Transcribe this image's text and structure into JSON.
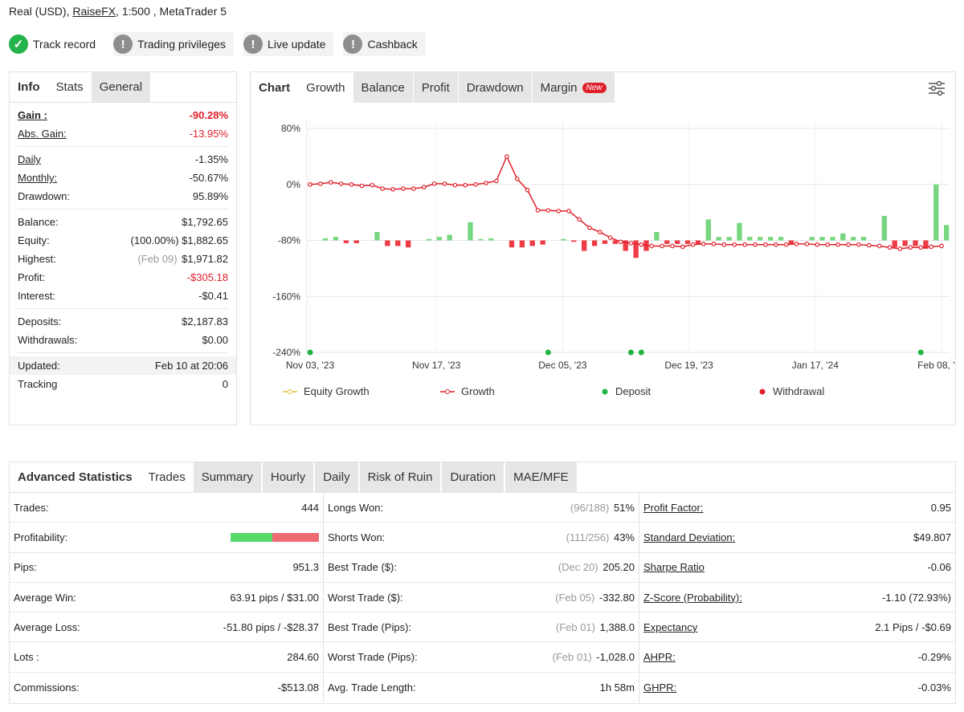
{
  "header": {
    "account_type": "Real (USD),",
    "broker": "RaiseFX",
    "leverage_platform": ", 1:500 , MetaTrader 5"
  },
  "badges": [
    {
      "label": "Track record",
      "status": "ok"
    },
    {
      "label": "Trading privileges",
      "status": "warn"
    },
    {
      "label": "Live update",
      "status": "warn"
    },
    {
      "label": "Cashback",
      "status": "warn"
    }
  ],
  "info": {
    "tabs": [
      "Info",
      "Stats",
      "General"
    ],
    "gain_label": "Gain :",
    "gain": "-90.28%",
    "abs_gain_label": "Abs. Gain:",
    "abs_gain": "-13.95%",
    "daily_label": "Daily",
    "daily": "-1.35%",
    "monthly_label": "Monthly:",
    "monthly": "-50.67%",
    "drawdown_label": "Drawdown:",
    "drawdown": "95.89%",
    "balance_label": "Balance:",
    "balance": "$1,792.65",
    "equity_label": "Equity:",
    "equity_pct": "(100.00%)",
    "equity": "$1,882.65",
    "highest_label": "Highest:",
    "highest_date": "(Feb 09)",
    "highest": "$1,971.82",
    "profit_label": "Profit:",
    "profit": "-$305.18",
    "interest_label": "Interest:",
    "interest": "-$0.41",
    "deposits_label": "Deposits:",
    "deposits": "$2,187.83",
    "withdrawals_label": "Withdrawals:",
    "withdrawals": "$0.00",
    "updated_label": "Updated:",
    "updated": "Feb 10 at 20:06",
    "tracking_label": "Tracking",
    "tracking": "0"
  },
  "chart_tabs": {
    "title": "Chart",
    "tabs": [
      "Growth",
      "Balance",
      "Profit",
      "Drawdown",
      "Margin"
    ],
    "new_badge": "New"
  },
  "chart_data": {
    "type": "line",
    "y_ticks": [
      "80%",
      "0%",
      "-80%",
      "-160%",
      "-240%"
    ],
    "ylim": [
      -240,
      80
    ],
    "x_ticks": [
      "Nov 03, '23",
      "Nov 17, '23",
      "Dec 05, '23",
      "Dec 19, '23",
      "Jan 17, '24",
      "Feb 08, '24"
    ],
    "growth": [
      0,
      1,
      3,
      1,
      0,
      -2,
      -1,
      -6,
      -7,
      -6,
      -6,
      -4,
      1,
      1,
      -1,
      -1,
      0,
      2,
      5,
      40,
      8,
      -8,
      -37,
      -37,
      -38,
      -38,
      -50,
      -62,
      -68,
      -76,
      -82,
      -84,
      -86,
      -88,
      -88,
      -88,
      -89,
      -86,
      -85,
      -85,
      -86,
      -86,
      -86,
      -86,
      -86,
      -86,
      -86,
      -85,
      -85,
      -86,
      -86,
      -86,
      -86,
      -86,
      -87,
      -88,
      -90,
      -92,
      -90,
      -90,
      -89,
      -88
    ],
    "bars": [
      0,
      3,
      5,
      -4,
      -4,
      0,
      12,
      -8,
      -8,
      -10,
      0,
      2,
      5,
      8,
      0,
      26,
      2,
      3,
      0,
      -10,
      -10,
      -8,
      -6,
      0,
      2,
      -2,
      -15,
      -8,
      -5,
      -5,
      -15,
      -25,
      -15,
      12,
      -5,
      -5,
      -5,
      -5,
      30,
      5,
      5,
      25,
      5,
      5,
      5,
      5,
      -5,
      0,
      5,
      5,
      5,
      10,
      5,
      5,
      0,
      35,
      -10,
      -8,
      -8,
      -12,
      80,
      22
    ],
    "deposit_points": [
      0,
      19,
      25,
      26,
      48
    ],
    "legend": [
      "Equity Growth",
      "Growth",
      "Deposit",
      "Withdrawal"
    ],
    "colors": {
      "growth": "#e0202a",
      "bar_pos": "#77d680",
      "bar_neg": "#ee3b44",
      "deposit": "#20b440",
      "withdrawal": "#e0202a",
      "equity": "#e4c23a"
    }
  },
  "stats": {
    "tabs": [
      "Advanced Statistics",
      "Trades",
      "Summary",
      "Hourly",
      "Daily",
      "Risk of Ruin",
      "Duration",
      "MAE/MFE"
    ],
    "col1": [
      {
        "label": "Trades:",
        "value": "444"
      },
      {
        "label": "Profitability:",
        "value": ""
      },
      {
        "label": "Pips:",
        "value": "951.3"
      },
      {
        "label": "Average Win:",
        "value": "63.91 pips / $31.00"
      },
      {
        "label": "Average Loss:",
        "value": "-51.80 pips / -$28.37"
      },
      {
        "label": "Lots :",
        "value": "284.60"
      },
      {
        "label": "Commissions:",
        "value": "-$513.08"
      }
    ],
    "col2": [
      {
        "label": "Longs Won:",
        "muted": "(96/188)",
        "value": "51%"
      },
      {
        "label": "Shorts Won:",
        "muted": "(111/256)",
        "value": "43%"
      },
      {
        "label": "Best Trade ($):",
        "muted": "(Dec 20)",
        "value": "205.20"
      },
      {
        "label": "Worst Trade ($):",
        "muted": "(Feb 05)",
        "value": "-332.80"
      },
      {
        "label": "Best Trade (Pips):",
        "muted": "(Feb 01)",
        "value": "1,388.0"
      },
      {
        "label": "Worst Trade (Pips):",
        "muted": "(Feb 01)",
        "value": "-1,028.0"
      },
      {
        "label": "Avg. Trade Length:",
        "muted": "",
        "value": "1h 58m"
      }
    ],
    "col3": [
      {
        "label": "Profit Factor:",
        "value": "0.95"
      },
      {
        "label": "Standard Deviation:",
        "value": "$49.807"
      },
      {
        "label": "Sharpe Ratio",
        "value": "-0.06"
      },
      {
        "label": "Z-Score (Probability):",
        "value": "-1.10 (72.93%)"
      },
      {
        "label": "Expectancy",
        "value": "2.1 Pips / -$0.69"
      },
      {
        "label": "AHPR:",
        "value": "-0.29%"
      },
      {
        "label": "GHPR:",
        "value": "-0.03%"
      }
    ],
    "profitability_win_fraction": 0.47
  }
}
